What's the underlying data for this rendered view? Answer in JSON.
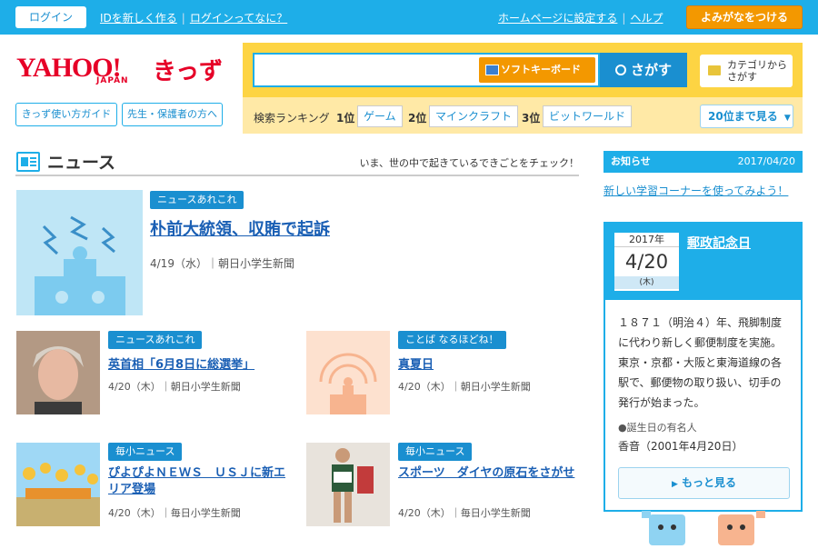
{
  "topbar": {
    "login": "ログイン",
    "create_id": "IDを新しく作る",
    "about_login": "ログインってなに？",
    "set_homepage": "ホームページに設定する",
    "help": "ヘルプ",
    "furigana": "よみがなをつける"
  },
  "logo": {
    "yahoo": "YAHOO!",
    "japan": "JAPAN",
    "kids": "きっず"
  },
  "guides": {
    "usage_guide": "きっず使い方ガイド",
    "for_teachers": "先生・保護者の方へ"
  },
  "search": {
    "placeholder": "",
    "soft_keyboard": "ソフトキーボード",
    "search_button": "さがす",
    "category_line1": "カテゴリから",
    "category_line2": "さがす"
  },
  "ranking": {
    "title": "検索ランキング",
    "items": [
      {
        "rank": "1位",
        "label": "ゲーム"
      },
      {
        "rank": "2位",
        "label": "マインクラフト"
      },
      {
        "rank": "3位",
        "label": "ビットワールド"
      }
    ],
    "more": "20位まで見る"
  },
  "news": {
    "title": "ニュース",
    "tagline": "いま、世の中で起きているできごとをチェック！",
    "featured": {
      "category": "ニュースあれこれ",
      "title": "朴前大統領、収賄で起訴",
      "meta": "4/19（水）｜朝日小学生新聞"
    },
    "articles": [
      {
        "category": "ニュースあれこれ",
        "title": "英首相「6月8日に総選挙」",
        "meta": "4/20（木）｜朝日小学生新聞"
      },
      {
        "category": "ことば なるほどね！",
        "title": "真夏日",
        "meta": "4/20（木）｜朝日小学生新聞"
      },
      {
        "category": "毎小ニュース",
        "title": "ぴよぴよＮＥＷＳ　ＵＳＪに新エリア登場",
        "meta": "4/20（木）｜毎日小学生新聞"
      },
      {
        "category": "毎小ニュース",
        "title": "スポーツ　ダイヤの原石をさがせ",
        "meta": "4/20（木）｜毎日小学生新聞"
      }
    ]
  },
  "notice": {
    "label": "お知らせ",
    "date": "2017/04/20",
    "link": "新しい学習コーナーを使ってみよう！"
  },
  "today": {
    "year": "2017年",
    "date": "4/20",
    "dow": "(木)",
    "title": "郵政記念日",
    "text": "１８７１（明治４）年、飛脚制度に代わり新しく郵便制度を実施。東京・京都・大阪と東海道線の各駅で、郵便物の取り扱い、切手の発行が始まった。",
    "birthday_label": "●誕生日の有名人",
    "birthday_person": "香音（2001年4月20日）",
    "more": "もっと見る"
  },
  "colors": {
    "accent_blue": "#1eaee8",
    "link_blue": "#1a5fb4",
    "orange": "#f39800",
    "yellow": "#fdd443",
    "brand_red": "#e60027"
  }
}
